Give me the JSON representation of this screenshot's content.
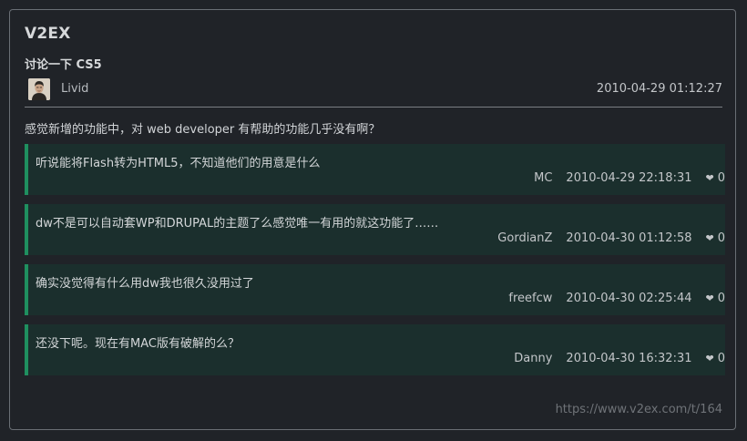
{
  "site": {
    "title": "V2EX"
  },
  "topic": {
    "title": "讨论一下 CS5",
    "author": "Livid",
    "time": "2010-04-29 01:12:27",
    "body": "感觉新增的功能中，对 web developer 有帮助的功能几乎没有啊？"
  },
  "replies": [
    {
      "text": "听说能将Flash转为HTML5，不知道他们的用意是什么",
      "author": "MC",
      "time": "2010-04-29 22:18:31",
      "likes": "0"
    },
    {
      "text": "dw不是可以自动套WP和DRUPAL的主题了么感觉唯一有用的就这功能了……",
      "author": "GordianZ",
      "time": "2010-04-30 01:12:58",
      "likes": "0"
    },
    {
      "text": "确实没觉得有什么用dw我也很久没用过了",
      "author": "freefcw",
      "time": "2010-04-30 02:25:44",
      "likes": "0"
    },
    {
      "text": "还没下呢。现在有MAC版有破解的么？",
      "author": "Danny",
      "time": "2010-04-30 16:32:31",
      "likes": "0"
    }
  ],
  "icons": {
    "heart": "heart-icon",
    "avatar": "avatar"
  },
  "footer": {
    "url": "https://www.v2ex.com/t/164"
  },
  "colors": {
    "accent": "#1f8f5f",
    "reply_bg": "#1b2f2d",
    "page_bg": "#202328"
  }
}
